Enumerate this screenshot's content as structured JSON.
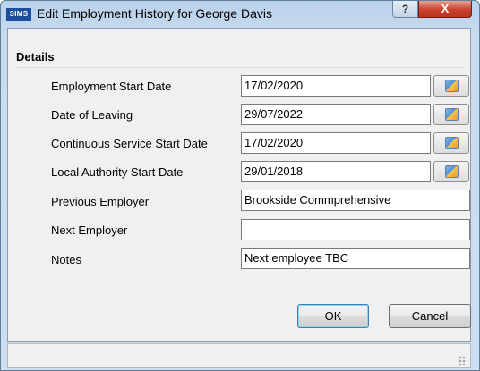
{
  "window": {
    "logo_text": "SIMS",
    "title": "Edit Employment History for George Davis",
    "help_symbol": "?",
    "close_symbol": "X"
  },
  "section": {
    "title": "Details"
  },
  "fields": {
    "employment_start": {
      "label": "Employment Start Date",
      "value": "17/02/2020"
    },
    "date_of_leaving": {
      "label": "Date of Leaving",
      "value": "29/07/2022"
    },
    "continuous_service": {
      "label": "Continuous Service Start Date",
      "value": "17/02/2020"
    },
    "local_authority": {
      "label": "Local Authority Start Date",
      "value": "29/01/2018"
    },
    "previous_employer": {
      "label": "Previous Employer",
      "value": "Brookside Commprehensive"
    },
    "next_employer": {
      "label": "Next Employer",
      "value": ""
    },
    "notes": {
      "label": "Notes",
      "value": "Next employee TBC"
    }
  },
  "buttons": {
    "ok": "OK",
    "cancel": "Cancel"
  },
  "icons": {
    "calendar": "calendar-icon"
  }
}
